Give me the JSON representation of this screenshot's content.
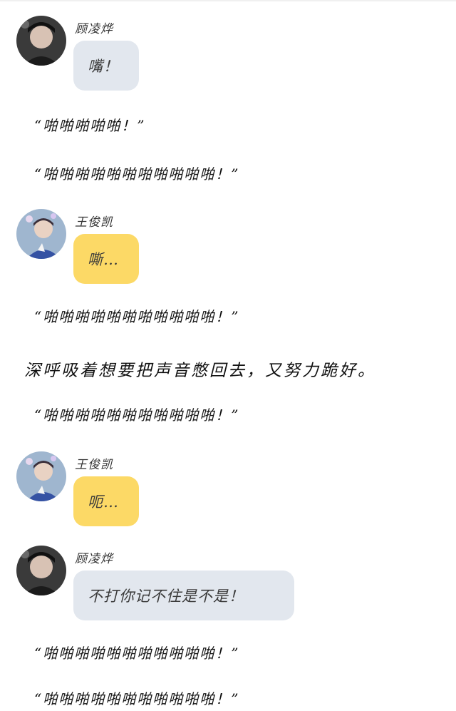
{
  "chat": {
    "messages": [
      {
        "sender": "顾凌烨",
        "text": "嘴！",
        "style": "gray",
        "avatar": "avatar-gu-lingye"
      },
      {
        "sender": "王俊凯",
        "text": "嘶…",
        "style": "yellow",
        "avatar": "avatar-wang-junkai"
      },
      {
        "sender": "王俊凯",
        "text": "呃…",
        "style": "yellow",
        "avatar": "avatar-wang-junkai"
      },
      {
        "sender": "顾凌烨",
        "text": "不打你记不住是不是！",
        "style": "gray",
        "avatar": "avatar-gu-lingye"
      }
    ],
    "lines": [
      "“啪啪啪啪啪！”",
      "“啪啪啪啪啪啪啪啪啪啪啪！”",
      "“啪啪啪啪啪啪啪啪啪啪啪！”",
      "深呼吸着想要把声音憋回去，又努力跪好。",
      "“啪啪啪啪啪啪啪啪啪啪啪！”",
      "“啪啪啪啪啪啪啪啪啪啪啪！”",
      "“啪啪啪啪啪啪啪啪啪啪啪！”"
    ]
  },
  "colors": {
    "bubble_gray": "#e2e7ee",
    "bubble_yellow": "#fcd966",
    "background": "#ffffff"
  }
}
